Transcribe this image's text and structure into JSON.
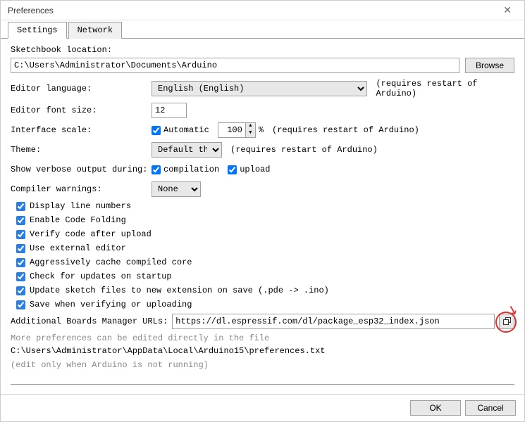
{
  "window": {
    "title": "Preferences"
  },
  "tabs": {
    "settings": "Settings",
    "network": "Network"
  },
  "sketchbook": {
    "label": "Sketchbook location:",
    "path": "C:\\Users\\Administrator\\Documents\\Arduino",
    "browse": "Browse"
  },
  "editor_language": {
    "label": "Editor language:",
    "value": "English (English)",
    "hint": "(requires restart of Arduino)"
  },
  "font_size": {
    "label": "Editor font size:",
    "value": "12"
  },
  "interface_scale": {
    "label": "Interface scale:",
    "automatic": "Automatic",
    "value": "100",
    "percent": "%",
    "hint": "(requires restart of Arduino)"
  },
  "theme": {
    "label": "Theme:",
    "value": "Default theme",
    "hint": "(requires restart of Arduino)"
  },
  "verbose": {
    "label": "Show verbose output during:",
    "compilation": "compilation",
    "upload": "upload"
  },
  "compiler_warnings": {
    "label": "Compiler warnings:",
    "value": "None"
  },
  "checks": {
    "line_numbers": "Display line numbers",
    "code_folding": "Enable Code Folding",
    "verify_upload": "Verify code after upload",
    "external_editor": "Use external editor",
    "cache_core": "Aggressively cache compiled core",
    "check_updates": "Check for updates on startup",
    "update_sketch": "Update sketch files to new extension on save (.pde -> .ino)",
    "save_verify": "Save when verifying or uploading"
  },
  "boards_url": {
    "label": "Additional Boards Manager URLs:",
    "value": "https://dl.espressif.com/dl/package_esp32_index.json"
  },
  "more_prefs": {
    "line1": "More preferences can be edited directly in the file",
    "path": "C:\\Users\\Administrator\\AppData\\Local\\Arduino15\\preferences.txt",
    "line2": "(edit only when Arduino is not running)"
  },
  "footer": {
    "ok": "OK",
    "cancel": "Cancel"
  }
}
